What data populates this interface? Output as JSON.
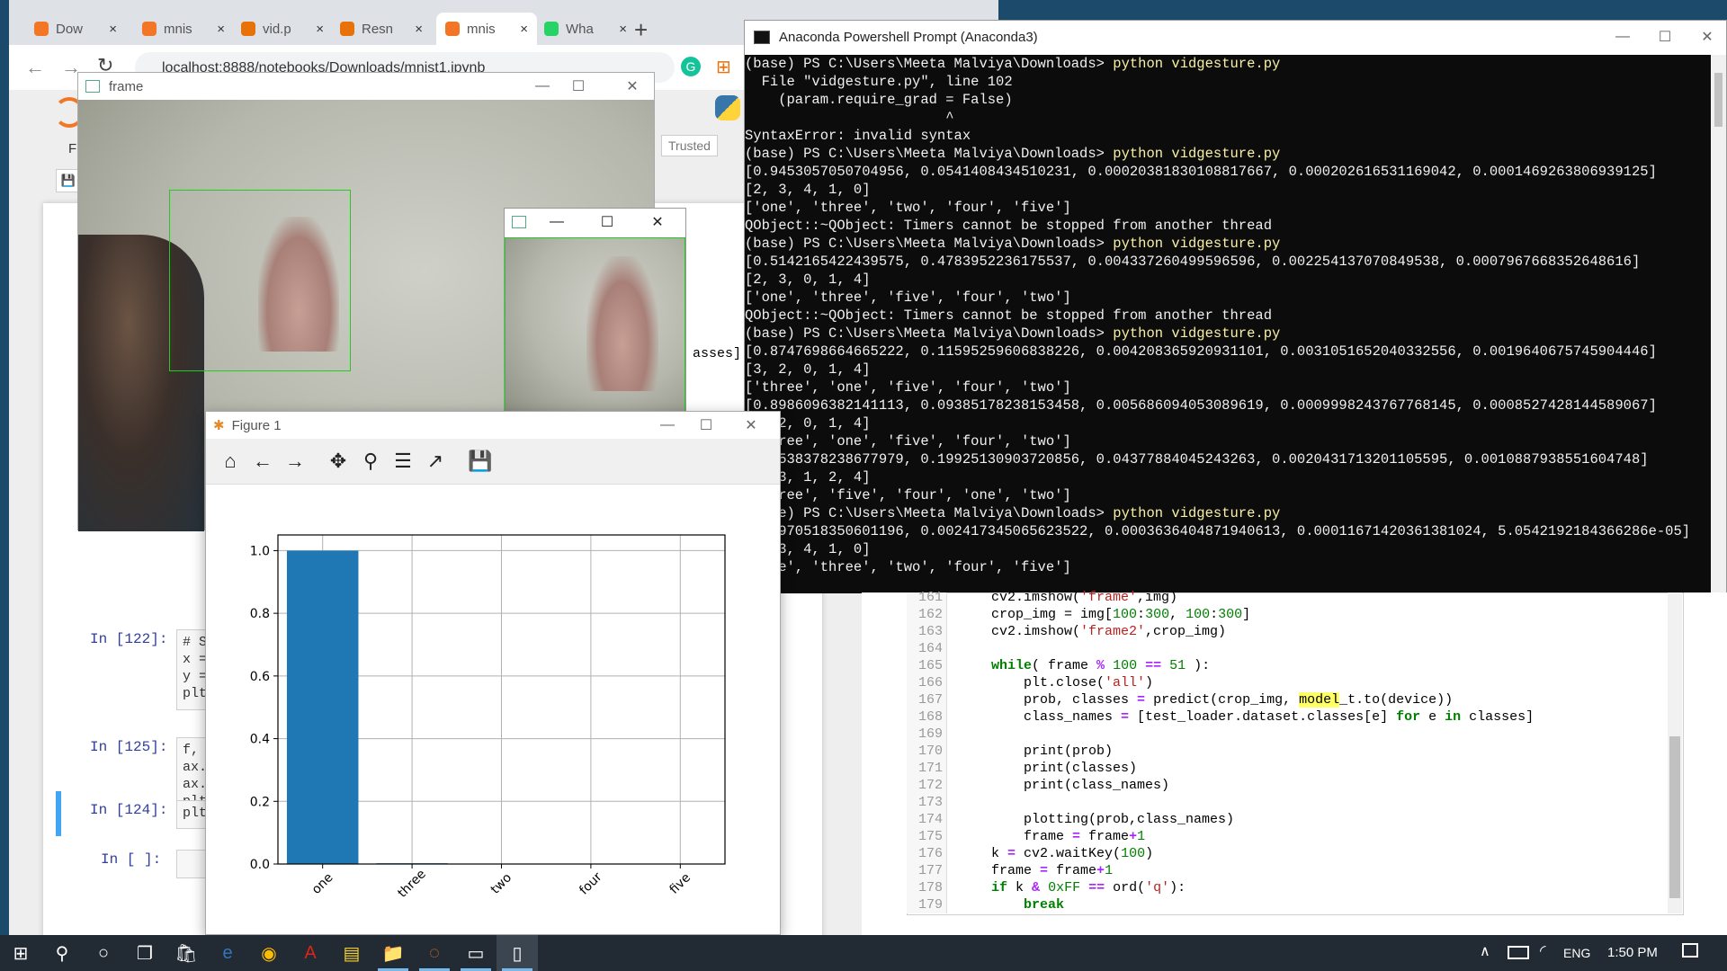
{
  "browser": {
    "tabs": [
      {
        "label": "Dow",
        "icon": "refresh-orange-icon"
      },
      {
        "label": "mnis",
        "icon": "notebook-icon"
      },
      {
        "label": "vid.p",
        "icon": "file-icon"
      },
      {
        "label": "Resn",
        "icon": "colab-icon"
      },
      {
        "label": "mnis",
        "icon": "notebook-icon"
      },
      {
        "label": "Wha",
        "icon": "whatsapp-icon"
      }
    ],
    "new_tab": "+",
    "close_glyph": "×",
    "url": "localhost:8888/notebooks/Downloads/mnist1.ipynb"
  },
  "jupyter": {
    "menu_partial": "F",
    "trusted": "Trusted",
    "output_fragment": "asses]",
    "cells": [
      {
        "prompt": "In [122]:",
        "lines": [
          "# Si",
          "x =",
          "y =",
          "",
          "plt."
        ]
      },
      {
        "prompt": "In [125]:",
        "lines": [
          "f, a",
          "ax.p",
          "ax.s",
          "plt."
        ]
      },
      {
        "prompt": "In [124]:",
        "lines": [
          "plt."
        ]
      },
      {
        "prompt": "In [ ]:",
        "lines": [
          ""
        ]
      }
    ]
  },
  "frame_window": {
    "title": "frame"
  },
  "frame2_window": {
    "title": ""
  },
  "figure": {
    "title": "Figure 1",
    "tools": [
      "home-icon",
      "back-arrow-icon",
      "forward-arrow-icon",
      "pan-icon",
      "zoom-icon",
      "configure-subplots-icon",
      "edit-axis-icon",
      "save-icon"
    ],
    "tool_glyphs": [
      "⌂",
      "←",
      "→",
      "✥",
      "⚲",
      "☰",
      "↗",
      "💾"
    ]
  },
  "chart_data": {
    "type": "bar",
    "categories": [
      "one",
      "three",
      "two",
      "four",
      "five"
    ],
    "values": [
      0.9998,
      0.0024,
      0.00036,
      0.00012,
      5e-05
    ],
    "title": "",
    "xlabel": "",
    "ylabel": "",
    "ylim": [
      0,
      1.05
    ],
    "yticks": [
      "0.0",
      "0.2",
      "0.4",
      "0.6",
      "0.8",
      "1.0"
    ],
    "grid": true,
    "bar_color": "#1f77b4"
  },
  "terminal": {
    "title": "Anaconda Powershell Prompt (Anaconda3)",
    "lines": [
      {
        "text": "(base) PS C:\\Users\\Meeta Malviya\\Downloads> ",
        "cmd": "python vidgesture.py"
      },
      {
        "text": "  File \"vidgesture.py\", line 102"
      },
      {
        "text": "    (param.require_grad = False)"
      },
      {
        "text": "                        ^"
      },
      {
        "text": "SyntaxError: invalid syntax"
      },
      {
        "text": "(base) PS C:\\Users\\Meeta Malviya\\Downloads> ",
        "cmd": "python vidgesture.py"
      },
      {
        "text": "[0.9453057050704956, 0.0541408434510231, 0.00020381830108817667, 0.00020261653116904​2, 0.0001469263806939125]"
      },
      {
        "text": "[2, 3, 4, 1, 0]"
      },
      {
        "text": "['one', 'three', 'two', 'four', 'five']"
      },
      {
        "text": "QObject::~QObject: Timers cannot be stopped from another thread"
      },
      {
        "text": "(base) PS C:\\Users\\Meeta Malviya\\Downloads> ",
        "cmd": "python vidgesture.py"
      },
      {
        "text": "[0.5142165422439575, 0.4783952236175537, 0.004337260499596596, 0.002254137070849538, 0.0007967668352648616]"
      },
      {
        "text": "[2, 3, 0, 1, 4]"
      },
      {
        "text": "['one', 'three', 'five', 'four', 'two']"
      },
      {
        "text": "QObject::~QObject: Timers cannot be stopped from another thread"
      },
      {
        "text": "(base) PS C:\\Users\\Meeta Malviya\\Downloads> ",
        "cmd": "python vidgesture.py"
      },
      {
        "text": "[0.8747698664665222, 0.11595259606838226, 0.004208365920931101, 0.0031051652040332556, 0.0019640675745904446]"
      },
      {
        "text": "[3, 2, 0, 1, 4]"
      },
      {
        "text": "['three', 'one', 'five', 'four', 'two']"
      },
      {
        "text": "[0.8986096382141113, 0.09385178238153458, 0.005686094053089619, 0.0009998243767768145, 0.0008527428144589067]"
      },
      {
        "text": "[3, 2, 0, 1, 4]"
      },
      {
        "text": "['three', 'one', 'five', 'four', 'two']"
      },
      {
        "text": "[0.7538378238677979, 0.19925130903720856, 0.04377884045243263, 0.0020431713201105595, 0.0010887938551604748]"
      },
      {
        "text": "[0, 3, 1, 2, 4]"
      },
      {
        "text": "['three', 'five', 'four', 'one', 'two']"
      },
      {
        "text": "(base) PS C:\\Users\\Meeta Malviya\\Downloads> ",
        "cmd": "python vidgesture.py"
      },
      {
        "text": "[0.9970518350601196, 0.002417345065623522, 0.0003636404871940613, 0.00011671420361381024, 5.0542192184366286e-05]"
      },
      {
        "text": "[2, 3, 4, 1, 0]"
      },
      {
        "text": "['one', 'three', 'two', 'four', 'five']"
      }
    ]
  },
  "editor": {
    "lines": [
      {
        "n": "161",
        "html": "    cv2.imshow(<span class='str'>'frame'</span>,img)"
      },
      {
        "n": "162",
        "html": "    crop_img = img[<span class='num'>100</span>:<span class='num'>300</span>, <span class='num'>100</span>:<span class='num'>300</span>]"
      },
      {
        "n": "163",
        "html": "    cv2.imshow(<span class='str'>'frame2'</span>,crop_img)"
      },
      {
        "n": "164",
        "html": ""
      },
      {
        "n": "165",
        "html": "    <span class='kw'>while</span>( frame <span class='op'>%</span> <span class='num'>100</span> <span class='op'>==</span> <span class='num'>51</span> ):"
      },
      {
        "n": "166",
        "html": "        plt.close(<span class='str'>'all'</span>)"
      },
      {
        "n": "167",
        "html": "        prob, classes <span class='op'>=</span> predict(crop_img, <span class='hl'>model</span>_t.to(device))"
      },
      {
        "n": "168",
        "html": "        class_names <span class='op'>=</span> [test_loader.dataset.classes[e] <span class='kw'>for</span> e <span class='kw'>in</span> classes]"
      },
      {
        "n": "169",
        "html": ""
      },
      {
        "n": "170",
        "html": "        print(prob)"
      },
      {
        "n": "171",
        "html": "        print(classes)"
      },
      {
        "n": "172",
        "html": "        print(class_names)"
      },
      {
        "n": "173",
        "html": ""
      },
      {
        "n": "174",
        "html": "        plotting(prob,class_names)"
      },
      {
        "n": "175",
        "html": "        frame <span class='op'>=</span> frame<span class='op'>+</span><span class='num'>1</span>"
      },
      {
        "n": "176",
        "html": "    k <span class='op'>=</span> cv2.waitKey(<span class='num'>100</span>)"
      },
      {
        "n": "177",
        "html": "    frame <span class='op'>=</span> frame<span class='op'>+</span><span class='num'>1</span>"
      },
      {
        "n": "178",
        "html": "    <span class='kw'>if</span> k <span class='op'>&amp;</span> <span class='num'>0xFF</span> <span class='op'>==</span> ord(<span class='str'>'q'</span>):"
      },
      {
        "n": "179",
        "html": "        <span class='kw'>break</span>"
      }
    ]
  },
  "taskbar": {
    "icons": [
      {
        "name": "start-windows-icon",
        "glyph": "⊞"
      },
      {
        "name": "search-icon",
        "glyph": "⚲"
      },
      {
        "name": "cortana-icon",
        "glyph": "○"
      },
      {
        "name": "task-view-icon",
        "glyph": "❐"
      },
      {
        "name": "store-icon",
        "glyph": "🛍"
      },
      {
        "name": "edge-icon",
        "glyph": "e"
      },
      {
        "name": "chrome-icon",
        "glyph": "◉"
      },
      {
        "name": "acrobat-icon",
        "glyph": "A"
      },
      {
        "name": "sticky-notes-icon",
        "glyph": "▤"
      },
      {
        "name": "file-explorer-icon",
        "glyph": "📁"
      },
      {
        "name": "jupyter-icon",
        "glyph": "◌"
      },
      {
        "name": "terminal-icon",
        "glyph": "▭"
      },
      {
        "name": "document-icon",
        "glyph": "▯"
      }
    ],
    "language": "ENG",
    "time": "1:50 PM"
  }
}
